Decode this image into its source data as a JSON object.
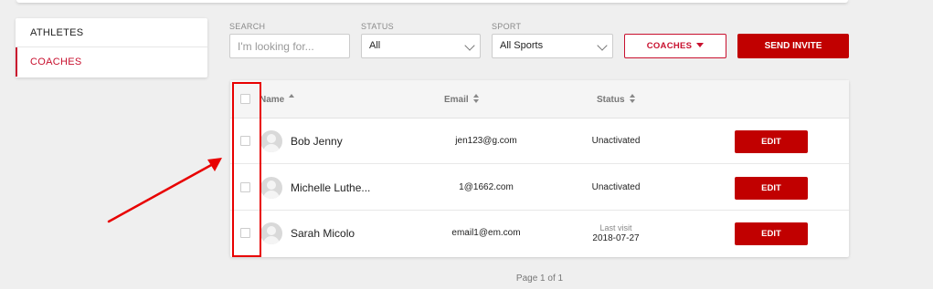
{
  "sidebar": {
    "items": [
      {
        "label": "ATHLETES",
        "active": false
      },
      {
        "label": "COACHES",
        "active": true
      }
    ]
  },
  "filters": {
    "search": {
      "label": "SEARCH",
      "placeholder": "I'm looking for..."
    },
    "status": {
      "label": "STATUS",
      "value": "All"
    },
    "sport": {
      "label": "SPORT",
      "value": "All Sports"
    }
  },
  "toolbar": {
    "coaches_label": "COACHES",
    "send_invite_label": "SEND INVITE"
  },
  "table": {
    "columns": {
      "name": "Name",
      "email": "Email",
      "status": "Status"
    },
    "rows": [
      {
        "name": "Bob Jenny",
        "email": "jen123@g.com",
        "status": "Unactivated",
        "edit": "EDIT"
      },
      {
        "name": "Michelle Luthe...",
        "email": "1@1662.com",
        "status": "Unactivated",
        "edit": "EDIT"
      },
      {
        "name": "Sarah Micolo",
        "email": "email1@em.com",
        "status_label": "Last visit",
        "status_date": "2018-07-27",
        "edit": "EDIT"
      }
    ]
  },
  "pager": {
    "text": "Page 1 of 1"
  },
  "colors": {
    "accent": "#c10000",
    "annotation": "#e80000",
    "background": "#efefef"
  }
}
